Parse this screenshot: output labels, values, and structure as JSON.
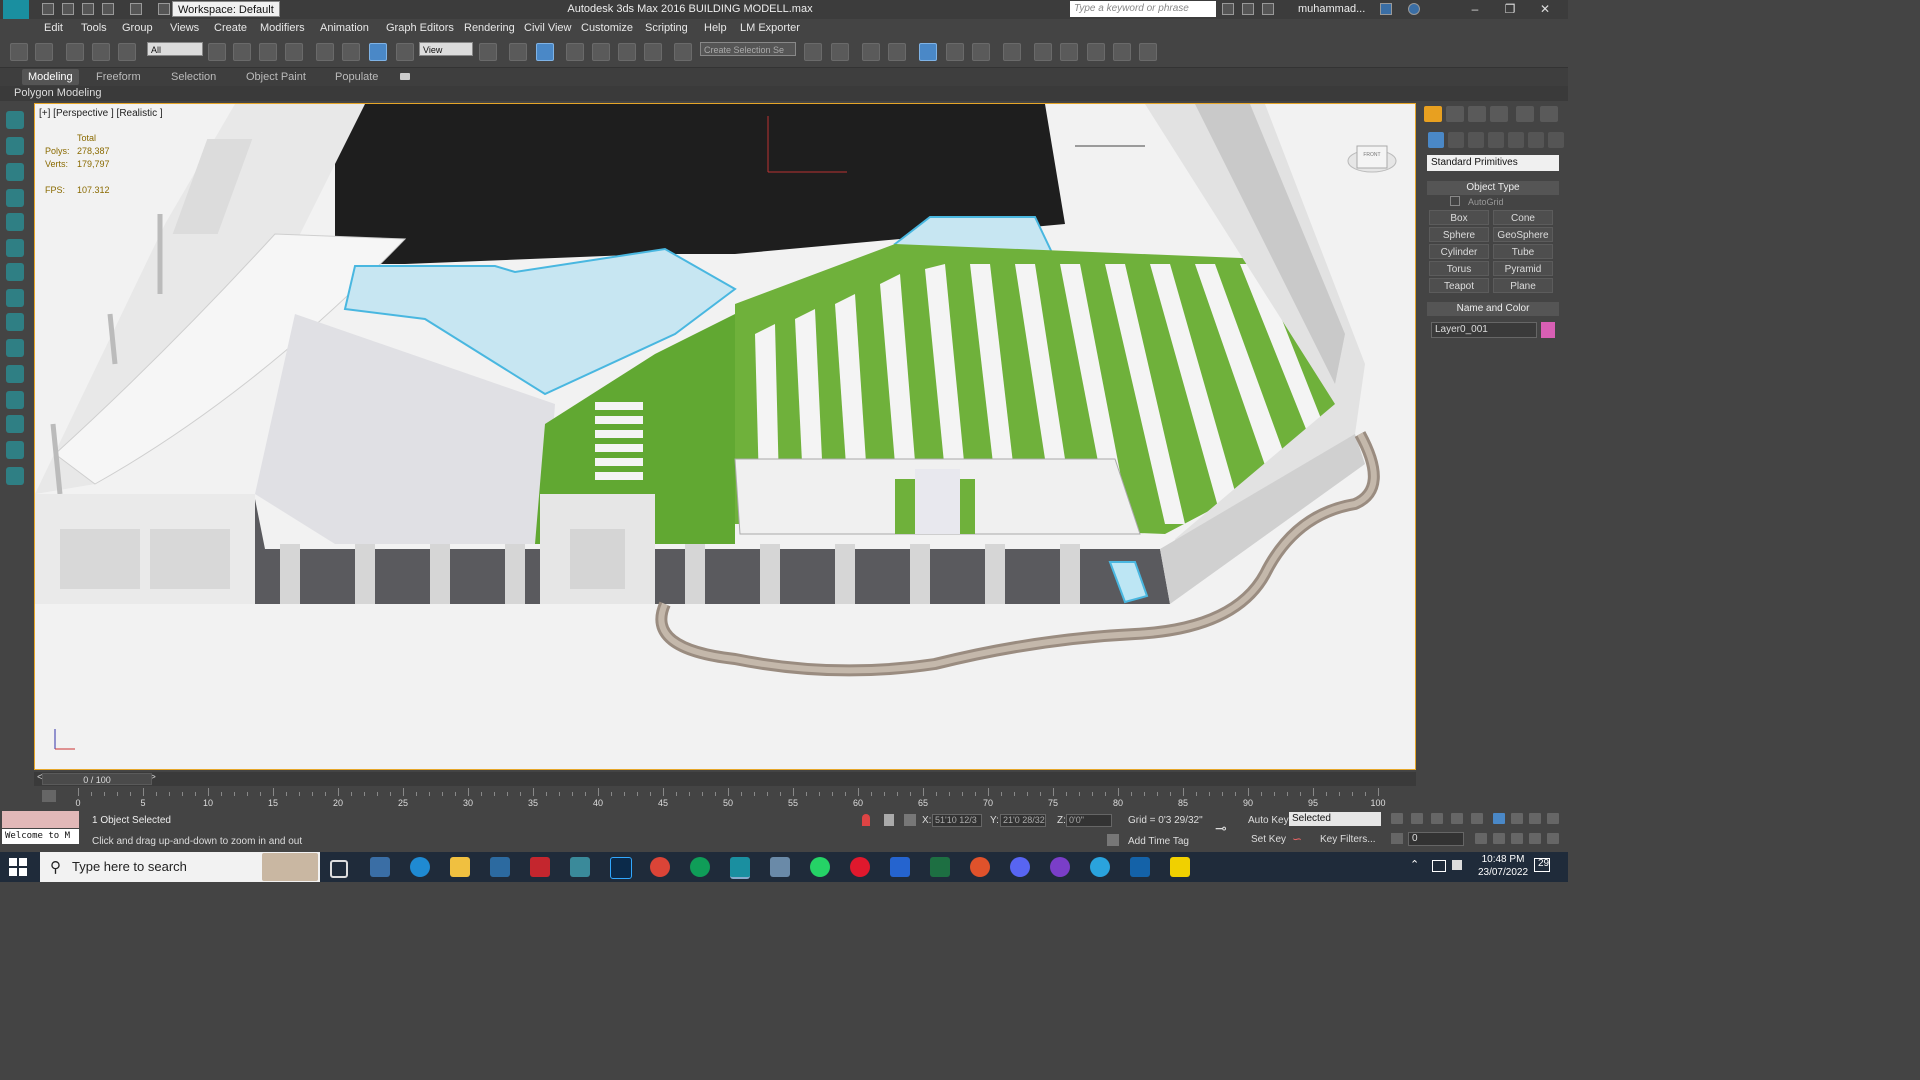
{
  "titlebar": {
    "title": "Autodesk 3ds Max 2016    BUILDING MODELL.max",
    "workspace": "Workspace: Default",
    "search_placeholder": "Type a keyword or phrase",
    "user": "muhammad..."
  },
  "menu": [
    "Edit",
    "Tools",
    "Group",
    "Views",
    "Create",
    "Modifiers",
    "Animation",
    "Graph Editors",
    "Rendering",
    "Civil View",
    "Customize",
    "Scripting",
    "Help",
    "LM Exporter"
  ],
  "toolbar": {
    "selection_filter": "All",
    "ref_coord": "View",
    "named_selection": "Create Selection Se"
  },
  "ribbon": {
    "tabs": [
      "Modeling",
      "Freeform",
      "Selection",
      "Object Paint",
      "Populate"
    ],
    "active_tab": "Modeling",
    "panel_label": "Polygon Modeling"
  },
  "viewport": {
    "label": "[+] [Perspective ] [Realistic ]",
    "stats": {
      "header": "Total",
      "polys_label": "Polys:",
      "polys": "278,387",
      "verts_label": "Verts:",
      "verts": "179,797",
      "fps_label": "FPS:",
      "fps": "107.312"
    },
    "viewcube_label": "FRONT"
  },
  "command_panel": {
    "category": "Standard Primitives",
    "object_type_title": "Object Type",
    "autogrid": "AutoGrid",
    "buttons": [
      "Box",
      "Cone",
      "Sphere",
      "GeoSphere",
      "Cylinder",
      "Tube",
      "Torus",
      "Pyramid",
      "Teapot",
      "Plane"
    ],
    "name_color_title": "Name and Color",
    "object_name": "Layer0_001",
    "object_color": "#d85fb4"
  },
  "timeline": {
    "position": "0 / 100",
    "ticks": [
      "0",
      "5",
      "10",
      "15",
      "20",
      "25",
      "30",
      "35",
      "40",
      "45",
      "50",
      "55",
      "60",
      "65",
      "70",
      "75",
      "80",
      "85",
      "90",
      "95",
      "100"
    ]
  },
  "status": {
    "welcome": "Welcome to M",
    "selected": "1 Object Selected",
    "prompt": "Click and drag up-and-down to zoom in and out",
    "x_label": "X:",
    "x": "51'10 12/3",
    "y_label": "Y:",
    "y": "21'0 28/32",
    "z_label": "Z:",
    "z": "0'0\"",
    "grid": "Grid = 0'3 29/32\"",
    "add_time_tag": "Add Time Tag",
    "auto_key": "Auto Key",
    "selected_mode": "Selected",
    "set_key": "Set Key",
    "key_filters": "Key Filters...",
    "frame": "0"
  },
  "taskbar": {
    "search": "Type here to search",
    "time": "10:48 PM",
    "date": "23/07/2022",
    "notifications": "29"
  }
}
